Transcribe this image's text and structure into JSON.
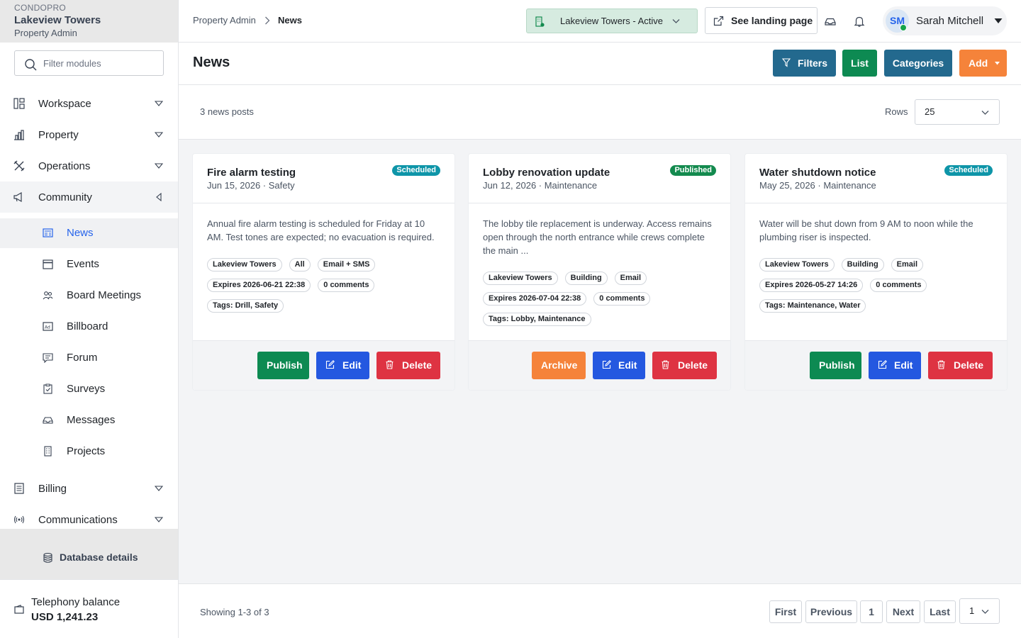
{
  "brand": {
    "app": "CONDOPRO",
    "property": "Lakeview Towers",
    "role": "Property Admin"
  },
  "sidebar": {
    "filter_placeholder": "Filter modules",
    "groups": [
      {
        "label": "Workspace",
        "icon": "layout-icon"
      },
      {
        "label": "Property",
        "icon": "building-chart-icon"
      },
      {
        "label": "Operations",
        "icon": "tools-icon"
      },
      {
        "label": "Community",
        "icon": "megaphone-icon"
      }
    ],
    "community_items": [
      {
        "label": "News",
        "icon": "newspaper-icon",
        "active": true
      },
      {
        "label": "Events",
        "icon": "calendar-icon"
      },
      {
        "label": "Board Meetings",
        "icon": "users-icon"
      },
      {
        "label": "Billboard",
        "icon": "ad-icon"
      },
      {
        "label": "Forum",
        "icon": "chat-icon"
      },
      {
        "label": "Surveys",
        "icon": "clipboard-icon"
      },
      {
        "label": "Messages",
        "icon": "inbox-icon"
      },
      {
        "label": "Projects",
        "icon": "office-icon"
      }
    ],
    "groups_bottom": [
      {
        "label": "Billing",
        "icon": "receipt-icon"
      },
      {
        "label": "Communications",
        "icon": "broadcast-icon"
      }
    ],
    "database_details": "Database details",
    "telephony": {
      "label": "Telephony balance",
      "value": "USD 1,241.23"
    }
  },
  "topbar": {
    "breadcrumb": [
      "Property Admin",
      "News"
    ],
    "property_select": "Lakeview Towers - Active",
    "landing_button": "See landing page",
    "user": {
      "initials": "SM",
      "name": "Sarah Mitchell"
    }
  },
  "page": {
    "title": "News",
    "buttons": {
      "filters": "Filters",
      "list": "List",
      "categories": "Categories",
      "add": "Add"
    },
    "count": "3 news posts",
    "rows_label": "Rows",
    "rows_value": "25"
  },
  "cards": [
    {
      "title": "Fire alarm testing",
      "meta": "Jun 15, 2026 · Safety",
      "status": "Scheduled",
      "status_color": "#0e95a8",
      "body": "Annual fire alarm testing is scheduled for Friday at 10 AM. Test tones are expected; no evacuation is required.",
      "chips": [
        [
          "Lakeview Towers",
          "All",
          "Email + SMS"
        ],
        [
          "Expires 2026-06-21 22:38",
          "0 comments"
        ],
        [
          "Tags: Drill, Safety"
        ]
      ],
      "actions": [
        "Publish",
        "Edit",
        "Delete"
      ]
    },
    {
      "title": "Lobby renovation update",
      "meta": "Jun 12, 2026 · Maintenance",
      "status": "Published",
      "status_color": "#138a4e",
      "body": "The lobby tile replacement is underway. Access remains open through the north entrance while crews complete the main ...",
      "chips": [
        [
          "Lakeview Towers",
          "Building",
          "Email"
        ],
        [
          "Expires 2026-07-04 22:38",
          "0 comments"
        ],
        [
          "Tags: Lobby, Maintenance"
        ]
      ],
      "actions": [
        "Archive",
        "Edit",
        "Delete"
      ]
    },
    {
      "title": "Water shutdown notice",
      "meta": "May 25, 2026 · Maintenance",
      "status": "Scheduled",
      "status_color": "#0e95a8",
      "body": "Water will be shut down from 9 AM to noon while the plumbing riser is inspected.",
      "chips": [
        [
          "Lakeview Towers",
          "Building",
          "Email"
        ],
        [
          "Expires 2026-05-27 14:26",
          "0 comments"
        ],
        [
          "Tags: Maintenance, Water"
        ]
      ],
      "actions": [
        "Publish",
        "Edit",
        "Delete"
      ]
    }
  ],
  "pager": {
    "showing": "Showing 1-3 of 3",
    "first": "First",
    "previous": "Previous",
    "page": "1",
    "next": "Next",
    "last": "Last",
    "page_select": "1"
  },
  "colors": {
    "publish": "#0d8a52",
    "edit": "#2458e0",
    "delete": "#de3342",
    "archive": "#f5833a",
    "filters": "#23698e",
    "list": "#0d8a52",
    "categories": "#23698e",
    "add": "#f5833a"
  }
}
